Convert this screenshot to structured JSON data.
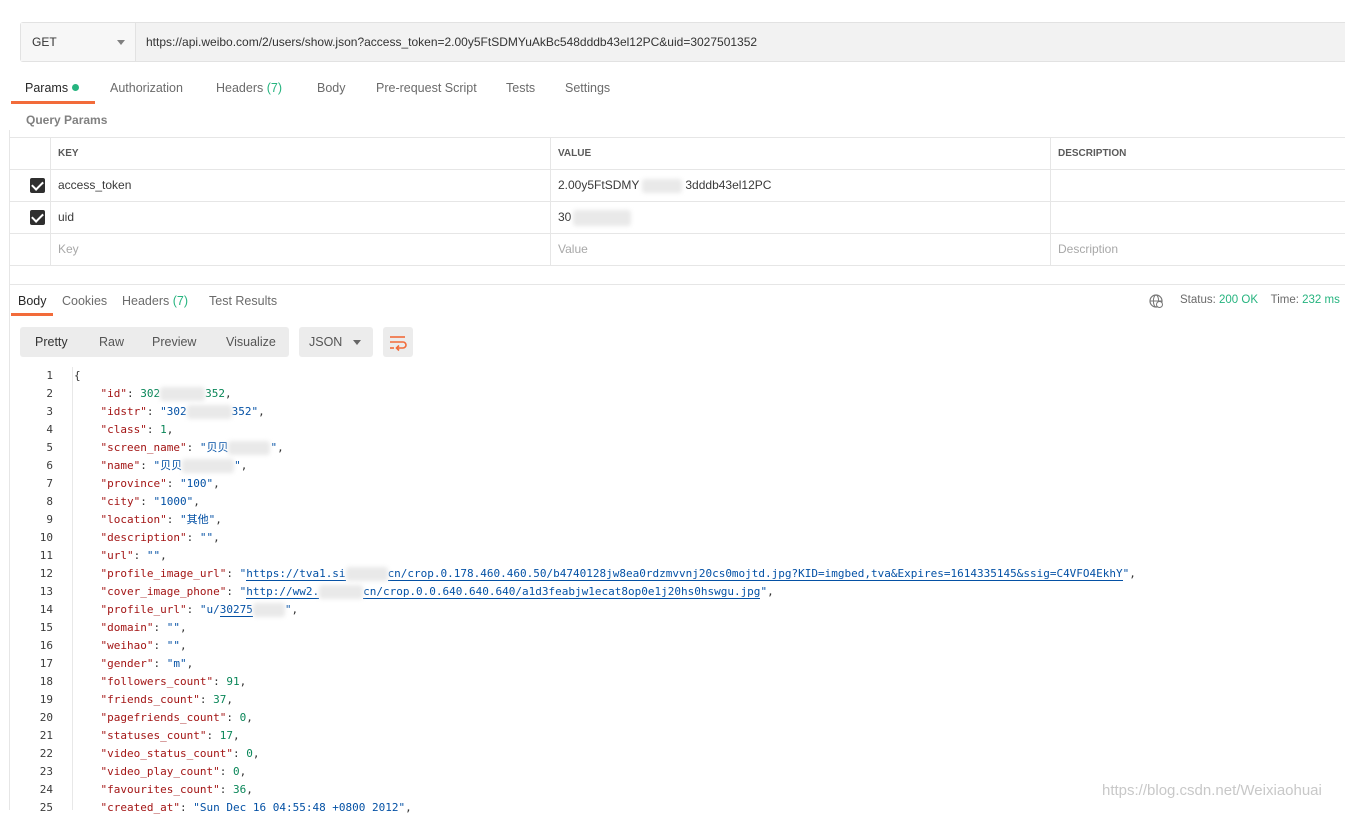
{
  "request": {
    "method": "GET",
    "url": "https://api.weibo.com/2/users/show.json?access_token=2.00y5FtSDMYuAkBc548dddb43el12PC&uid=3027501352"
  },
  "request_tabs": {
    "params": "Params",
    "authorization": "Authorization",
    "headers": "Headers",
    "headers_count": "(7)",
    "body": "Body",
    "prerequest": "Pre-request Script",
    "tests": "Tests",
    "settings": "Settings"
  },
  "query_params": {
    "title": "Query Params",
    "columns": {
      "key": "KEY",
      "value": "VALUE",
      "description": "DESCRIPTION"
    },
    "rows": [
      {
        "key": "access_token",
        "value_start": "2.00y5FtSDMY",
        "value_end": "3dddb43el12PC",
        "checked": true
      },
      {
        "key": "uid",
        "value_start": "30",
        "value_end": "",
        "checked": true
      }
    ],
    "placeholders": {
      "key": "Key",
      "value": "Value",
      "description": "Description"
    }
  },
  "response_tabs": {
    "body": "Body",
    "cookies": "Cookies",
    "headers": "Headers",
    "headers_count": "(7)",
    "test_results": "Test Results"
  },
  "response_status": {
    "status_label": "Status:",
    "status_value": "200 OK",
    "time_label": "Time:",
    "time_value": "232 ms"
  },
  "viewer": {
    "pretty": "Pretty",
    "raw": "Raw",
    "preview": "Preview",
    "visualize": "Visualize",
    "format": "JSON"
  },
  "code_lines": [
    {
      "n": "1",
      "key": "",
      "val": "",
      "text": "{"
    },
    {
      "n": "2",
      "key": "\"id\"",
      "val": "302",
      "t": "num",
      "suffix": "",
      "blur": true,
      "val2": "352",
      "comma": ","
    },
    {
      "n": "3",
      "key": "\"idstr\"",
      "val": "\"302",
      "t": "str",
      "blur": true,
      "val2": "352\"",
      "comma": ","
    },
    {
      "n": "4",
      "key": "\"class\"",
      "val": "1",
      "t": "num",
      "comma": ","
    },
    {
      "n": "5",
      "key": "\"screen_name\"",
      "val": "\"贝贝",
      "t": "str",
      "blur": true,
      "val2": "\"",
      "comma": ","
    },
    {
      "n": "6",
      "key": "\"name\"",
      "val": "\"贝贝",
      "t": "str",
      "blur": true,
      "val2": "\"",
      "comma": ","
    },
    {
      "n": "7",
      "key": "\"province\"",
      "val": "\"100\"",
      "t": "str",
      "comma": ","
    },
    {
      "n": "8",
      "key": "\"city\"",
      "val": "\"1000\"",
      "t": "str",
      "comma": ","
    },
    {
      "n": "9",
      "key": "\"location\"",
      "val": "\"其他\"",
      "t": "str",
      "comma": ","
    },
    {
      "n": "10",
      "key": "\"description\"",
      "val": "\"\"",
      "t": "str",
      "comma": ","
    },
    {
      "n": "11",
      "key": "\"url\"",
      "val": "\"\"",
      "t": "str",
      "comma": ","
    },
    {
      "n": "12",
      "key": "\"profile_image_url\"",
      "val": "\"",
      "t": "str",
      "link": "https://tva1.si",
      "blur": true,
      "link2": "cn/crop.0.178.460.460.50/b4740128jw8ea0rdzmvvnj20cs0mojtd.jpg?KID=imgbed,tva&Expires=1614335145&ssig=C4VFO4EkhY",
      "val2": "\"",
      "comma": ","
    },
    {
      "n": "13",
      "key": "\"cover_image_phone\"",
      "val": "\"",
      "t": "str",
      "link": "http://ww2.",
      "blur": true,
      "link2": "cn/crop.0.0.640.640.640/a1d3feabjw1ecat8op0e1j20hs0hswgu.jpg",
      "val2": "\"",
      "comma": ","
    },
    {
      "n": "14",
      "key": "\"profile_url\"",
      "val": "\"u/",
      "t": "str",
      "link": "30275",
      "blur": true,
      "val2": "\"",
      "comma": ","
    },
    {
      "n": "15",
      "key": "\"domain\"",
      "val": "\"\"",
      "t": "str",
      "comma": ","
    },
    {
      "n": "16",
      "key": "\"weihao\"",
      "val": "\"\"",
      "t": "str",
      "comma": ","
    },
    {
      "n": "17",
      "key": "\"gender\"",
      "val": "\"m\"",
      "t": "str",
      "comma": ","
    },
    {
      "n": "18",
      "key": "\"followers_count\"",
      "val": "91",
      "t": "num",
      "comma": ","
    },
    {
      "n": "19",
      "key": "\"friends_count\"",
      "val": "37",
      "t": "num",
      "comma": ","
    },
    {
      "n": "20",
      "key": "\"pagefriends_count\"",
      "val": "0",
      "t": "num",
      "comma": ","
    },
    {
      "n": "21",
      "key": "\"statuses_count\"",
      "val": "17",
      "t": "num",
      "comma": ","
    },
    {
      "n": "22",
      "key": "\"video_status_count\"",
      "val": "0",
      "t": "num",
      "comma": ","
    },
    {
      "n": "23",
      "key": "\"video_play_count\"",
      "val": "0",
      "t": "num",
      "comma": ","
    },
    {
      "n": "24",
      "key": "\"favourites_count\"",
      "val": "36",
      "t": "num",
      "comma": ","
    },
    {
      "n": "25",
      "key": "\"created_at\"",
      "val": "\"Sun Dec 16 04:55:48 +0800 2012\"",
      "t": "str",
      "comma": ","
    }
  ],
  "watermark": "https://blog.csdn.net/Weixiaohuai",
  "colors": {
    "accent": "#f26b3a",
    "ok": "#26b47f",
    "json_key": "#a31515",
    "json_string": "#0451a5",
    "json_number": "#098658"
  }
}
